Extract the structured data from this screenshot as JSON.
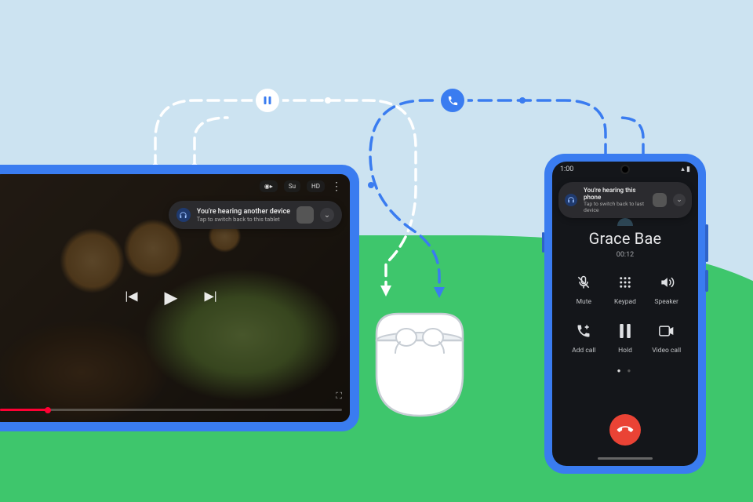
{
  "tablet": {
    "top": {
      "cast": "⬚",
      "cc": "Su",
      "hd": "HD"
    },
    "notif": {
      "title": "You're hearing another device",
      "sub": "Tap to switch back to this tablet"
    },
    "ctrls": {
      "prev": "|◀",
      "play": "▶",
      "next": "▶|"
    }
  },
  "phone": {
    "status": {
      "time": "1:00",
      "icons": "▴ ▮"
    },
    "notif": {
      "title": "You're hearing this phone",
      "sub": "Tap to switch back to last device"
    },
    "caller": {
      "name": "Grace Bae",
      "time": "00:12"
    },
    "btns": {
      "mute": "Mute",
      "keypad": "Keypad",
      "speaker": "Speaker",
      "addcall": "Add call",
      "hold": "Hold",
      "video": "Video call"
    }
  }
}
